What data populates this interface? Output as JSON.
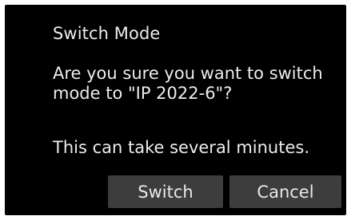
{
  "dialog": {
    "title": "Switch Mode",
    "message": "Are you sure you want to switch\nmode to \"IP 2022-6\"?",
    "note": "This can take several minutes.",
    "buttons": {
      "switch_label": "Switch",
      "cancel_label": "Cancel"
    }
  },
  "colors": {
    "dialog_background": "#000000",
    "text": "#ececec",
    "button_background": "#3d3d3d"
  }
}
